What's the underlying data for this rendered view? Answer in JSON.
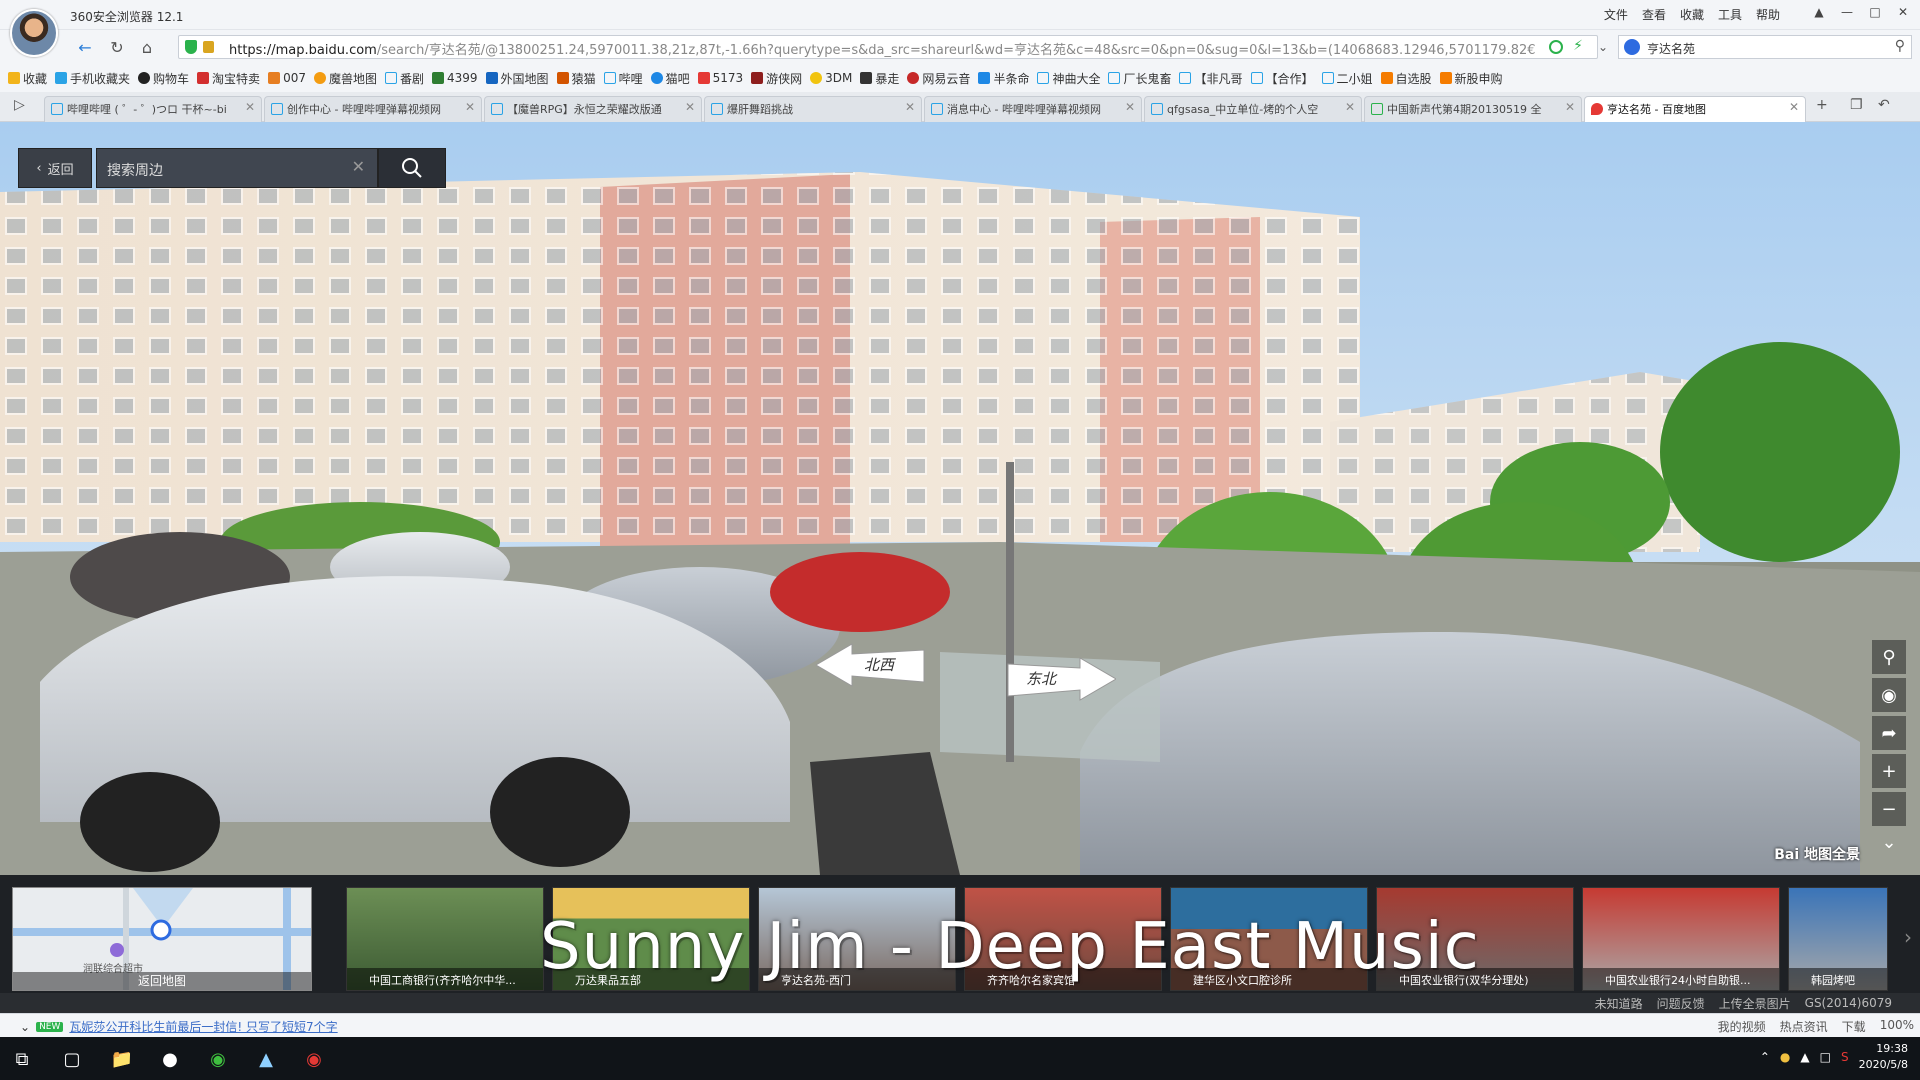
{
  "window": {
    "title": "360安全浏览器 12.1"
  },
  "menu": [
    "文件",
    "查看",
    "收藏",
    "工具",
    "帮助"
  ],
  "address": {
    "url_host": "https://map.baidu.com",
    "url_rest": "/search/亨达名苑/@13800251.24,5970011.38,21z,87t,-1.66h?querytype=s&da_src=shareurl&wd=亨达名苑&c=48&src=0&pn=0&sug=0&l=13&b=(14068683.12946,5701179.82€",
    "search_value": "亨达名苑"
  },
  "bookmarks": [
    "收藏",
    "手机收藏夹",
    "购物车",
    "淘宝特卖",
    "007",
    "魔兽地图",
    "番剧",
    "4399",
    "外国地图",
    "猿猫",
    "哔哩",
    "猫吧",
    "5173",
    "游侠网",
    "3DM",
    "暴走",
    "网易云音",
    "半条命",
    "神曲大全",
    "厂长鬼畜",
    "【非凡哥",
    "【合作】",
    "二小姐",
    "自选股",
    "新股申购"
  ],
  "tabs": [
    {
      "label": "哔哩哔哩 ( ゜- ゜)つロ 干杯~-bi"
    },
    {
      "label": "创作中心 - 哔哩哔哩弹幕视频网"
    },
    {
      "label": "【魔兽RPG】永恒之荣耀改版通"
    },
    {
      "label": "爆肝舞蹈挑战"
    },
    {
      "label": "消息中心 - 哔哩哔哩弹幕视频网"
    },
    {
      "label": "qfgsasa_中立单位-烤的个人空"
    },
    {
      "label": "中国新声代第4期20130519 全"
    },
    {
      "label": "亨达名苑 - 百度地图"
    }
  ],
  "pano": {
    "back_label": "返回",
    "search_placeholder": "搜索周边",
    "arrow_left": "北西",
    "arrow_right": "东北",
    "logo": "Bai 地图全景"
  },
  "minimap": {
    "label": "返回地图",
    "place1": "润联综合超市"
  },
  "thumbs": [
    {
      "caption": "中国工商银行(齐齐哈尔中华..."
    },
    {
      "caption": "万达果品五部"
    },
    {
      "caption": "亨达名苑-西门"
    },
    {
      "caption": "齐齐哈尔名家宾馆"
    },
    {
      "caption": "建华区小文口腔诊所"
    },
    {
      "caption": "中国农业银行(双华分理处)"
    },
    {
      "caption": "中国农业银行24小时自助银..."
    },
    {
      "caption": "韩园烤吧"
    }
  ],
  "overlay": "Sunny Jim - Deep East Music",
  "attribution": [
    "未知道路",
    "问题反馈",
    "上传全景图片",
    "GS(2014)6079"
  ],
  "status": {
    "news_badge": "NEW",
    "news_text": "瓦妮莎公开科比生前最后一封信! 只写了短短7个字",
    "right": [
      "我的视频",
      "热点资讯",
      "下载",
      "100%"
    ]
  },
  "clock": {
    "time": "19:38",
    "date": "2020/5/8"
  },
  "colors": {
    "accent": "#2bb24c",
    "link": "#3a6cc7"
  }
}
